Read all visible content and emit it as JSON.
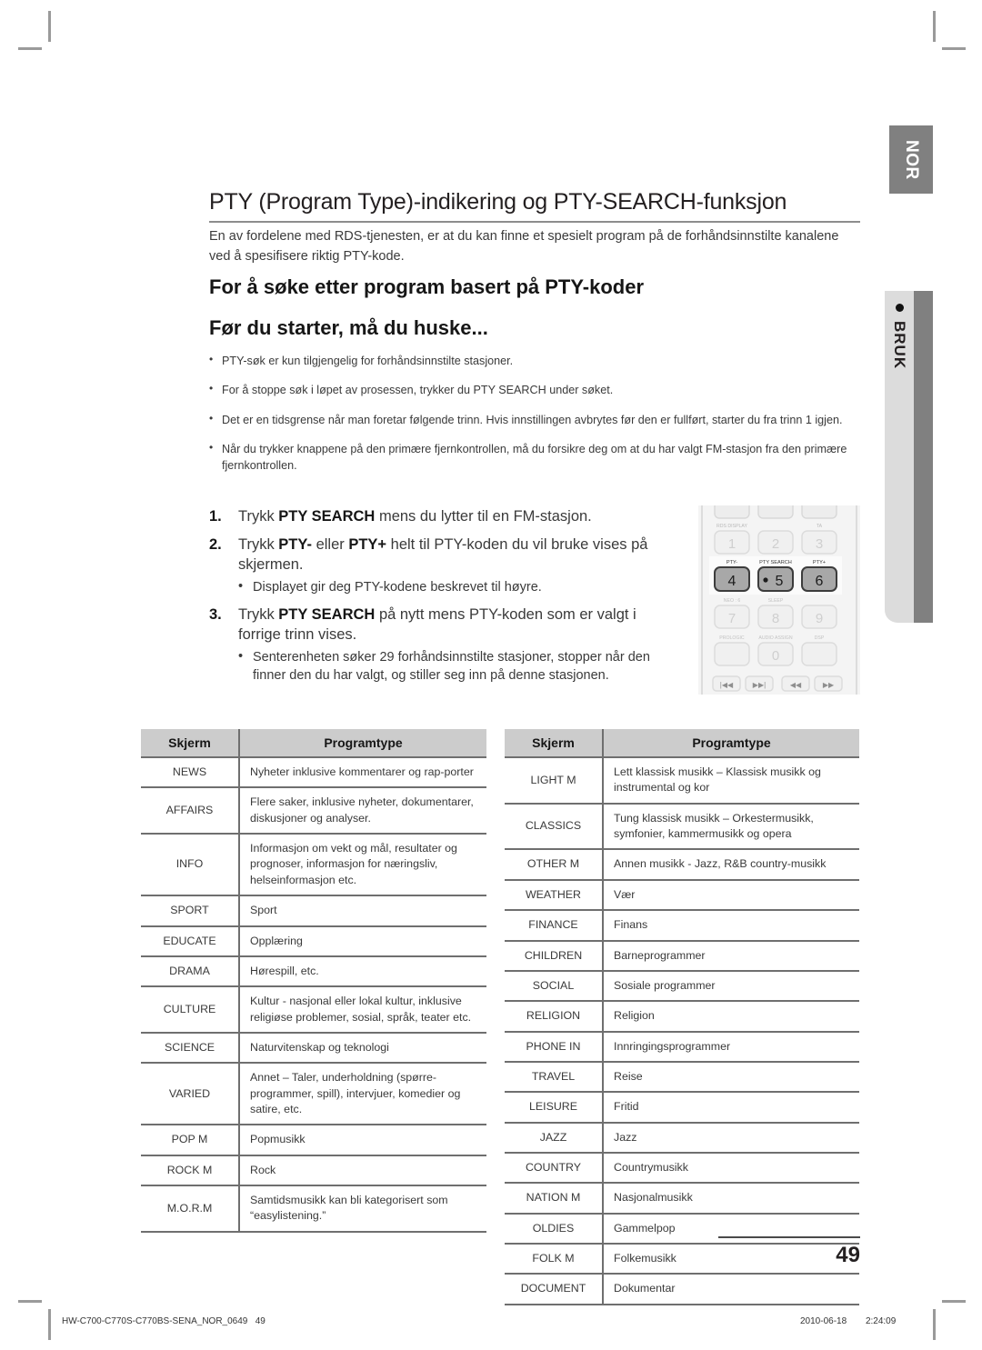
{
  "side_tabs": {
    "language": "NOR",
    "section": "BRUK"
  },
  "page": {
    "title": "PTY (Program Type)-indikering og PTY-SEARCH-funksjon",
    "intro": "En av fordelene med RDS-tjenesten, er at du kan finne et spesielt program på de forhåndsinnstilte kanalene ved å spesifisere riktig PTY-kode.",
    "subheading_1": "For å søke etter program basert på PTY-koder",
    "subheading_2": "Før du starter, må du huske...",
    "page_number": "49"
  },
  "notes": [
    "PTY-søk er kun tilgjengelig for forhåndsinnstilte stasjoner.",
    "For å stoppe søk i løpet av prosessen, trykker du PTY SEARCH under søket.",
    "Det er en tidsgrense når man foretar følgende trinn. Hvis innstillingen avbrytes før den er fullført, starter du fra trinn 1 igjen.",
    "Når du trykker knappene på den primære fjernkontrollen, må du forsikre deg om at du har valgt FM-stasjon fra den primære fjernkontrollen."
  ],
  "steps": [
    {
      "num": "1.",
      "pre": "Trykk ",
      "bold": "PTY SEARCH",
      "post": " mens du lytter til en FM-stasjon.",
      "sub": ""
    },
    {
      "num": "2.",
      "pre": "Trykk ",
      "bold": "PTY-",
      "mid": " eller ",
      "bold2": "PTY+",
      "post": " helt til PTY-koden du vil bruke vises på skjermen.",
      "sub": "Displayet gir deg PTY-kodene beskrevet til høyre."
    },
    {
      "num": "3.",
      "pre": "Trykk ",
      "bold": "PTY SEARCH",
      "post": " på nytt mens PTY-koden som er valgt i forrige trinn vises.",
      "sub": "Senterenheten søker 29 forhåndsinnstilte stasjoner, stopper når den finner den du har valgt, og stiller seg inn på denne stasjonen."
    }
  ],
  "remote": {
    "row_labels_top": [
      "RDS DISPLAY",
      "",
      "TA"
    ],
    "row_labels_mid": [
      "PTY-",
      "PTY SEARCH",
      "PTY+"
    ],
    "row_labels_low": [
      "NEO : 6",
      "SLEEP",
      ""
    ],
    "row_labels_bottom": [
      "PROLOGIC",
      "AUDIO ASSIGN",
      "DSP"
    ],
    "keys_row1": [
      "1",
      "2",
      "3"
    ],
    "keys_row2": [
      "4",
      "5",
      "6"
    ],
    "keys_row3": [
      "7",
      "8",
      "9"
    ],
    "key_zero": "0",
    "transport": [
      "◀◀|",
      "|▶▶",
      "◀◀",
      "▶▶"
    ],
    "highlight_color": "#9e9e9e",
    "body_color": "#f2f2f2"
  },
  "tables": {
    "headers": [
      "Skjerm",
      "Programtype"
    ],
    "left_rows": [
      [
        "NEWS",
        "Nyheter inklusive kommentarer og rap-porter"
      ],
      [
        "AFFAIRS",
        "Flere saker, inklusive nyheter, dokumentarer, diskusjoner og analyser."
      ],
      [
        "INFO",
        "Informasjon om vekt og mål, resultater og prognoser, informasjon for næringsliv, helseinformasjon etc."
      ],
      [
        "SPORT",
        "Sport"
      ],
      [
        "EDUCATE",
        "Opplæring"
      ],
      [
        "DRAMA",
        "Hørespill, etc."
      ],
      [
        "CULTURE",
        "Kultur - nasjonal eller lokal kultur, inklusive religiøse problemer, sosial, språk, teater etc."
      ],
      [
        "SCIENCE",
        "Naturvitenskap og teknologi"
      ],
      [
        "VARIED",
        "Annet – Taler, underholdning (spørre-programmer, spill), intervjuer, komedier og satire, etc."
      ],
      [
        "POP M",
        "Popmusikk"
      ],
      [
        "ROCK M",
        "Rock"
      ],
      [
        "M.O.R.M",
        "Samtidsmusikk kan bli kategorisert som “easylistening.”"
      ]
    ],
    "right_rows": [
      [
        "LIGHT M",
        "Lett klassisk musikk – Klassisk musikk og instrumental og kor"
      ],
      [
        "CLASSICS",
        "Tung klassisk musikk – Orkestermusikk, symfonier, kammermusikk og opera"
      ],
      [
        "OTHER M",
        "Annen musikk - Jazz, R&B country-musikk"
      ],
      [
        "WEATHER",
        "Vær"
      ],
      [
        "FINANCE",
        "Finans"
      ],
      [
        "CHILDREN",
        "Barneprogrammer"
      ],
      [
        "SOCIAL",
        "Sosiale programmer"
      ],
      [
        "RELIGION",
        "Religion"
      ],
      [
        "PHONE IN",
        "Innringingsprogrammer"
      ],
      [
        "TRAVEL",
        "Reise"
      ],
      [
        "LEISURE",
        "Fritid"
      ],
      [
        "JAZZ",
        "Jazz"
      ],
      [
        "COUNTRY",
        "Countrymusikk"
      ],
      [
        "NATION M",
        "Nasjonalmusikk"
      ],
      [
        "OLDIES",
        "Gammelpop"
      ],
      [
        "FOLK M",
        "Folkemusikk"
      ],
      [
        "DOCUMENT",
        "Dokumentar"
      ]
    ]
  },
  "footer": {
    "file_id": "HW-C700-C770S-C770BS-SENA_NOR_0649",
    "file_page": "49",
    "date": "2010-06-18",
    "time": "2:24:09"
  }
}
